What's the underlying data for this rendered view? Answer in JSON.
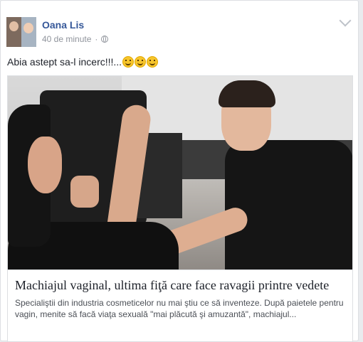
{
  "post": {
    "author": "Oana Lis",
    "time": "40 de minute",
    "separator": "·",
    "audience_icon": "globe-icon",
    "options_icon": "chevron-down-icon",
    "status_text": "Abia astept sa-l incerc!!!...",
    "emojis": [
      "winking-face-icon",
      "smiling-face-icon",
      "smiling-face-icon"
    ]
  },
  "link": {
    "title": "Machiajul vaginal, ultima fiţă care face ravagii printre vedete",
    "description": "Specialiştii din industria cosmeticelor nu mai ştiu ce să inventeze. După paietele pentru vagin, menite să facă viaţa sexuală \"mai plăcută şi amuzantă\", machiajul..."
  },
  "colors": {
    "author_link": "#365899",
    "meta_gray": "#90949c",
    "text": "#1d2129",
    "card_border": "#dddfe2",
    "page_bg": "#e9ebee"
  }
}
